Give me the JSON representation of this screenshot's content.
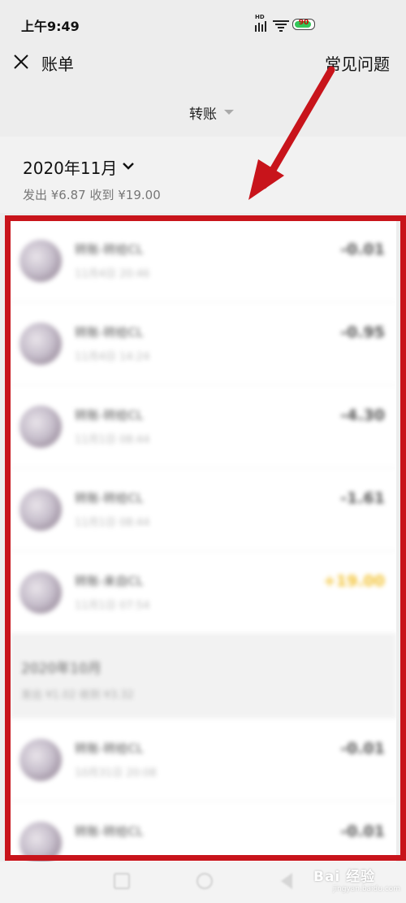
{
  "status_bar": {
    "time": "上午9:49",
    "network_label": "HD",
    "battery_level": "90"
  },
  "nav": {
    "title": "账单",
    "help_link": "常见问题",
    "close_icon": "close-icon"
  },
  "filter": {
    "label": "转账"
  },
  "month_header": {
    "label": "2020年11月",
    "summary": "发出 ¥6.87 收到 ¥19.00"
  },
  "transactions_nov": [
    {
      "title": "转账-转给CL",
      "date": "11月4日 20:46",
      "amount": "-0.01"
    },
    {
      "title": "转账-转给CL",
      "date": "11月4日 14:24",
      "amount": "-0.95"
    },
    {
      "title": "转账-转给CL",
      "date": "11月1日 08:44",
      "amount": "-4.30"
    },
    {
      "title": "转账-转给CL",
      "date": "11月1日 08:44",
      "amount": "-1.61"
    },
    {
      "title": "转账-来自CL",
      "date": "11月1日 07:54",
      "amount": "+19.00"
    }
  ],
  "month_oct": {
    "label": "2020年10月",
    "summary": "发出 ¥1.02 收到 ¥3.32"
  },
  "transactions_oct": [
    {
      "title": "转账-转给CL",
      "date": "10月31日 20:08",
      "amount": "-0.01"
    },
    {
      "title": "转账-转给CL",
      "date": "",
      "amount": "-0.01"
    }
  ],
  "watermark": {
    "text": "Bai 经验",
    "sub": "jingyan.baidu.com"
  },
  "colors": {
    "annotation_red": "#c8141b",
    "income_yellow": "#f2c232"
  }
}
